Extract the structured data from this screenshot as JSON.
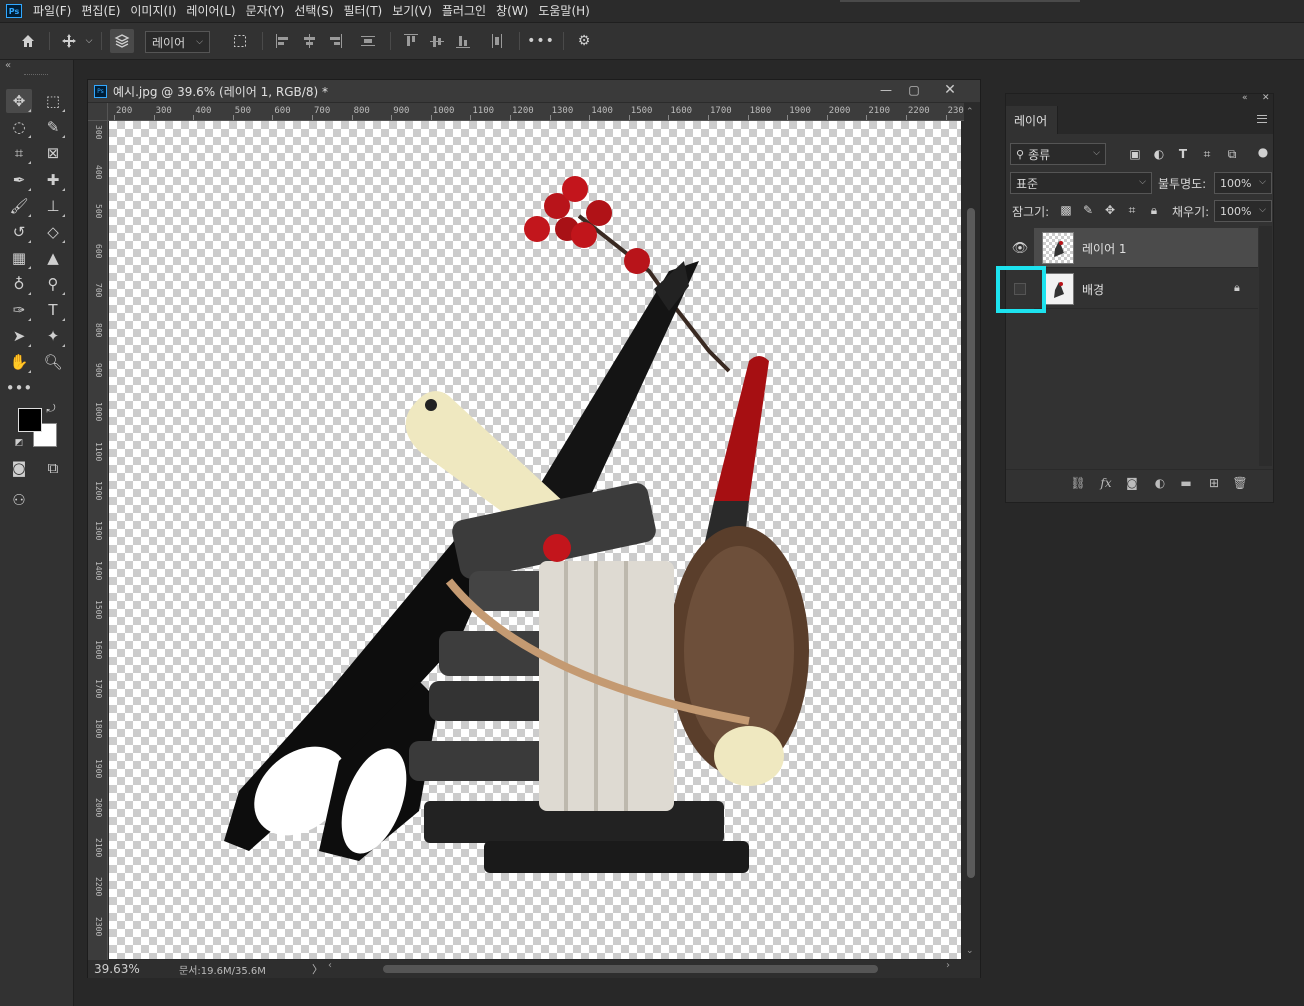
{
  "menubar": {
    "logo": "Ps",
    "items": [
      "파일(F)",
      "편집(E)",
      "이미지(I)",
      "레이어(L)",
      "문자(Y)",
      "선택(S)",
      "필터(T)",
      "보기(V)",
      "플러그인",
      "창(W)",
      "도움말(H)"
    ]
  },
  "optionsbar": {
    "auto_select_target": "레이어",
    "icons": [
      "home-icon",
      "move-icon",
      "auto-select-icon",
      "transform-controls-icon",
      "align-left-icon",
      "align-hcenter-icon",
      "align-right-icon",
      "distribute-icon",
      "align-top-icon",
      "align-vcenter-icon",
      "align-bottom-icon",
      "distribute-vertical-icon",
      "more-icon",
      "settings-icon"
    ]
  },
  "document": {
    "title": "예시.jpg @ 39.6% (레이어 1, RGB/8) *",
    "ruler_h": [
      "200",
      "300",
      "400",
      "500",
      "600",
      "700",
      "800",
      "900",
      "1000",
      "1100",
      "1200",
      "1300",
      "1400",
      "1500",
      "1600",
      "1700",
      "1800",
      "1900",
      "2000",
      "2100",
      "2200",
      "230"
    ],
    "ruler_v": [
      "300",
      "400",
      "500",
      "600",
      "700",
      "800",
      "900",
      "1000",
      "1100",
      "1200",
      "1300",
      "1400",
      "1500",
      "1600",
      "1700",
      "1800",
      "1900",
      "2000",
      "2100",
      "2200",
      "2300"
    ],
    "zoom": "39.63%",
    "doc_info": "문서:19.6M/35.6M",
    "status_arrow": "〉"
  },
  "layers_panel": {
    "tab": "레이어",
    "filter_kind": "종류",
    "blend_mode": "표준",
    "opacity_label": "불투명도:",
    "opacity_value": "100%",
    "lock_label": "잠그기:",
    "fill_label": "채우기:",
    "fill_value": "100%",
    "layers": [
      {
        "name": "레이어 1",
        "visible": true,
        "selected": true,
        "locked": false
      },
      {
        "name": "배경",
        "visible": false,
        "selected": false,
        "locked": true
      }
    ]
  },
  "colors": {
    "highlight": "#1de3ef",
    "foreground": "#000000",
    "background": "#ffffff"
  }
}
